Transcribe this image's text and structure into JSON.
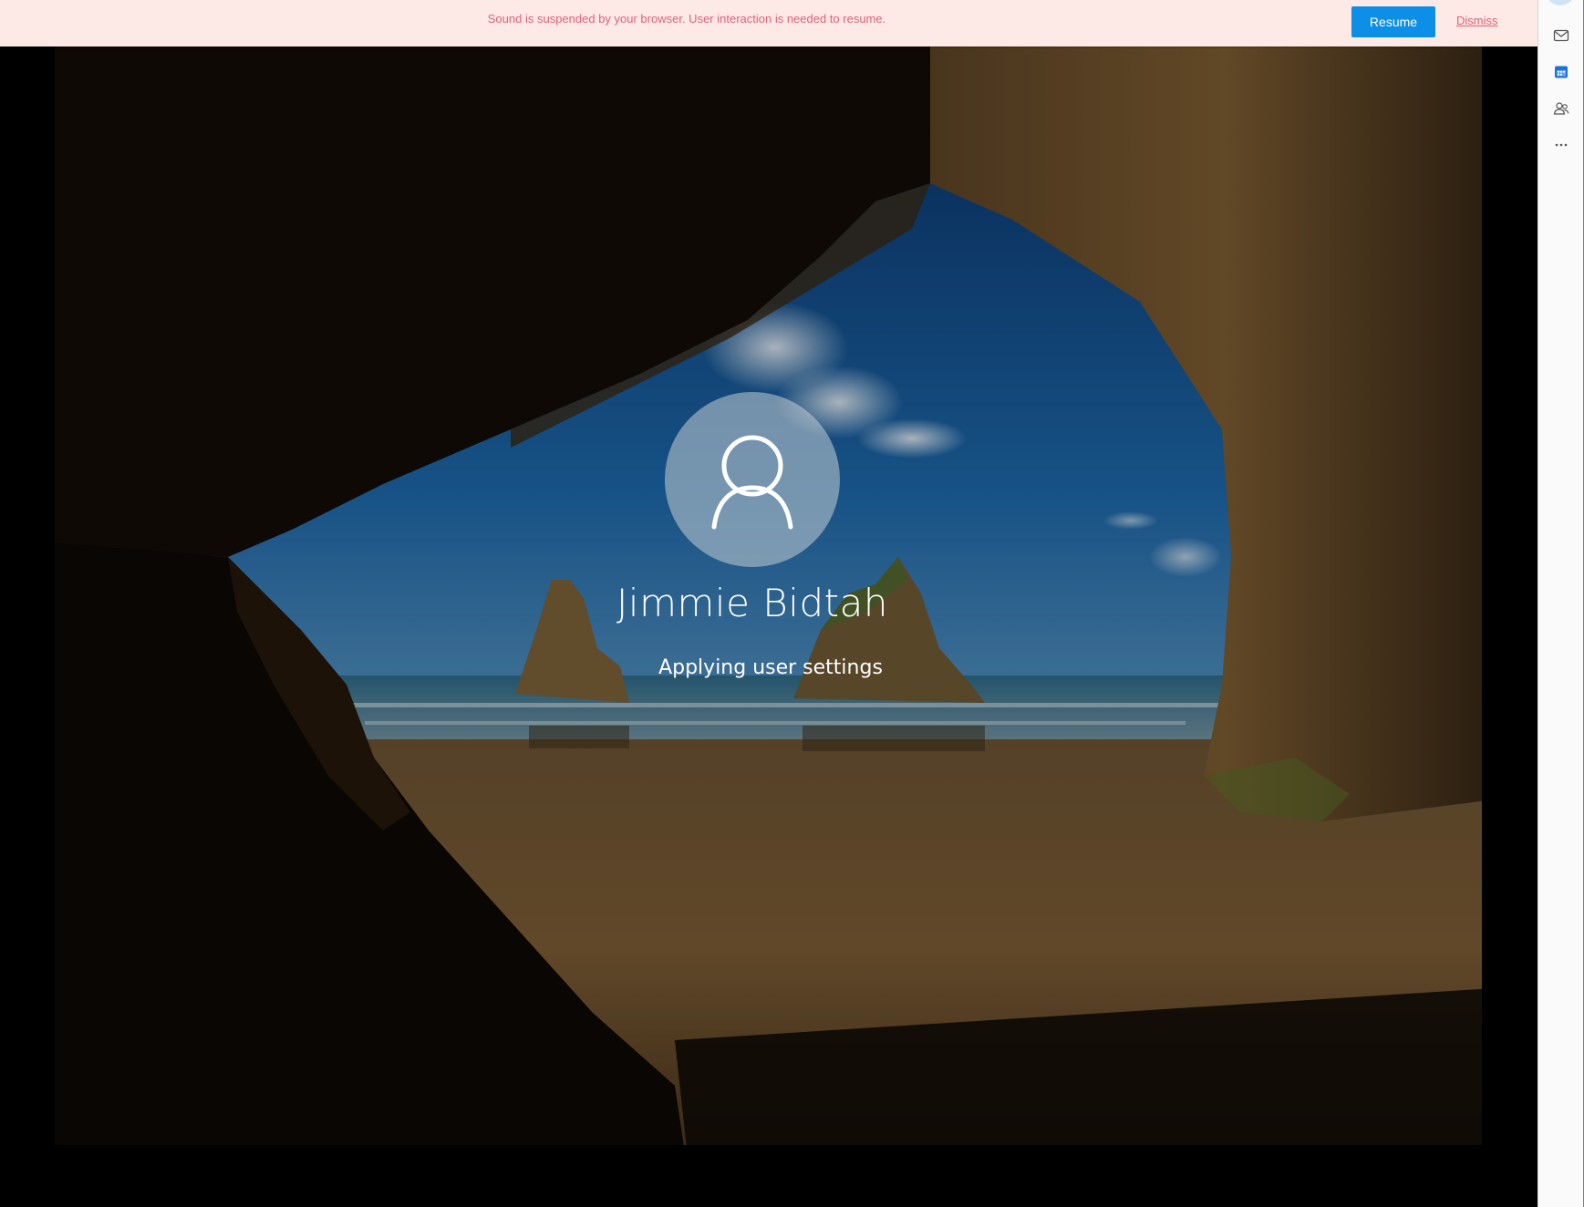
{
  "notification": {
    "message": "Sound is suspended by your browser. User interaction is needed to resume.",
    "resume_label": "Resume",
    "dismiss_label": "Dismiss",
    "background": "#fdeae6",
    "accent": "#0d8fe8"
  },
  "sidebar": {
    "items": [
      {
        "icon": "mail-icon"
      },
      {
        "icon": "calendar-icon"
      },
      {
        "icon": "people-icon"
      },
      {
        "icon": "more-icon"
      }
    ]
  },
  "login": {
    "user_name": "Jimmie Bidtah",
    "status": "Applying user settings",
    "avatar_icon": "user-icon"
  }
}
